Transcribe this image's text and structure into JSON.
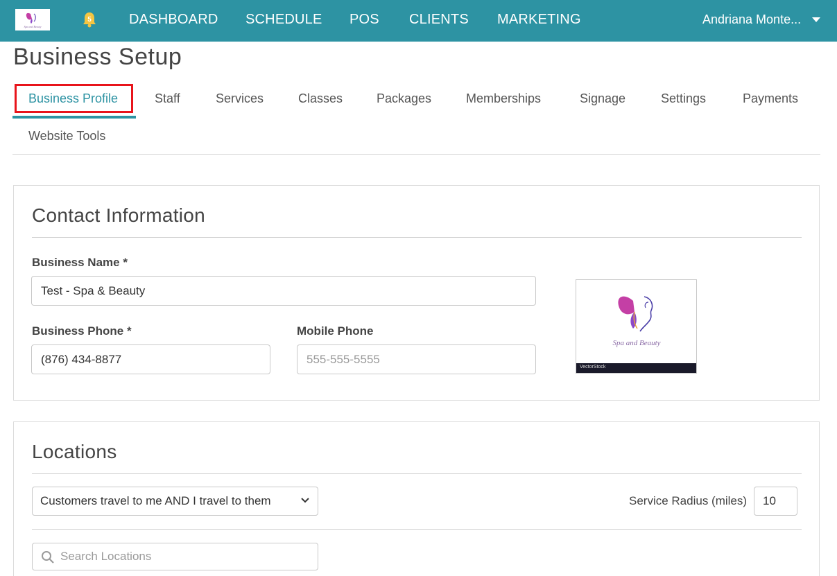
{
  "nav": {
    "items": [
      "DASHBOARD",
      "SCHEDULE",
      "POS",
      "CLIENTS",
      "MARKETING"
    ],
    "notification_count": "5",
    "user_name": "Andriana Monte...",
    "bar_color": "#2d93a3"
  },
  "page": {
    "title": "Business Setup"
  },
  "tabs": {
    "items": [
      "Business Profile",
      "Staff",
      "Services",
      "Classes",
      "Packages",
      "Memberships",
      "Signage",
      "Settings",
      "Payments",
      "Website Tools"
    ],
    "active": "Business Profile"
  },
  "contact": {
    "title": "Contact Information",
    "business_name_label": "Business Name *",
    "business_name_value": "Test - Spa & Beauty",
    "business_phone_label": "Business Phone *",
    "business_phone_value": "(876) 434-8877",
    "mobile_phone_label": "Mobile Phone",
    "mobile_phone_placeholder": "555-555-5555",
    "logo_text": "Spa and Beauty",
    "logo_watermark": "VectorStock"
  },
  "locations": {
    "title": "Locations",
    "travel_option": "Customers travel to me AND I travel to them",
    "service_radius_label": "Service Radius (miles)",
    "service_radius_value": "10",
    "search_placeholder": "Search Locations"
  }
}
